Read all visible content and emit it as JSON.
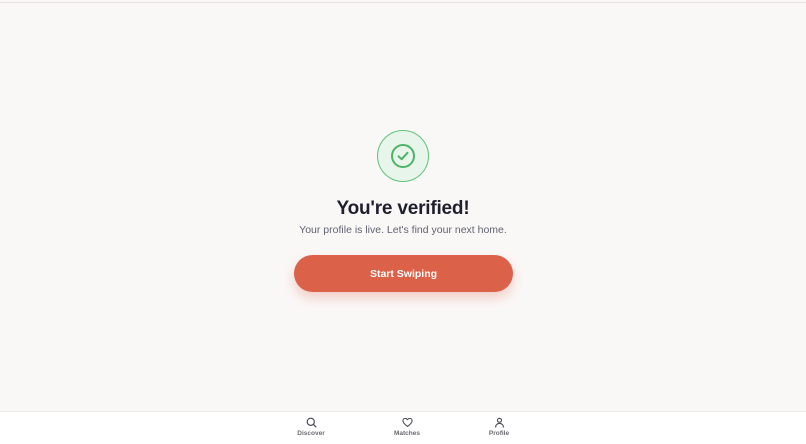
{
  "verification": {
    "icon": "check-circle-icon",
    "title": "You're verified!",
    "subtitle": "Your profile is live. Let's find your next home.",
    "cta_label": "Start Swiping"
  },
  "bottom_nav": {
    "items": [
      {
        "label": "Discover",
        "icon": "search-icon"
      },
      {
        "label": "Matches",
        "icon": "heart-icon"
      },
      {
        "label": "Profile",
        "icon": "user-icon"
      }
    ]
  },
  "colors": {
    "background": "#faf8f7",
    "accent": "#db6149",
    "success": "#5ec27a",
    "title": "#1f1f2e"
  }
}
